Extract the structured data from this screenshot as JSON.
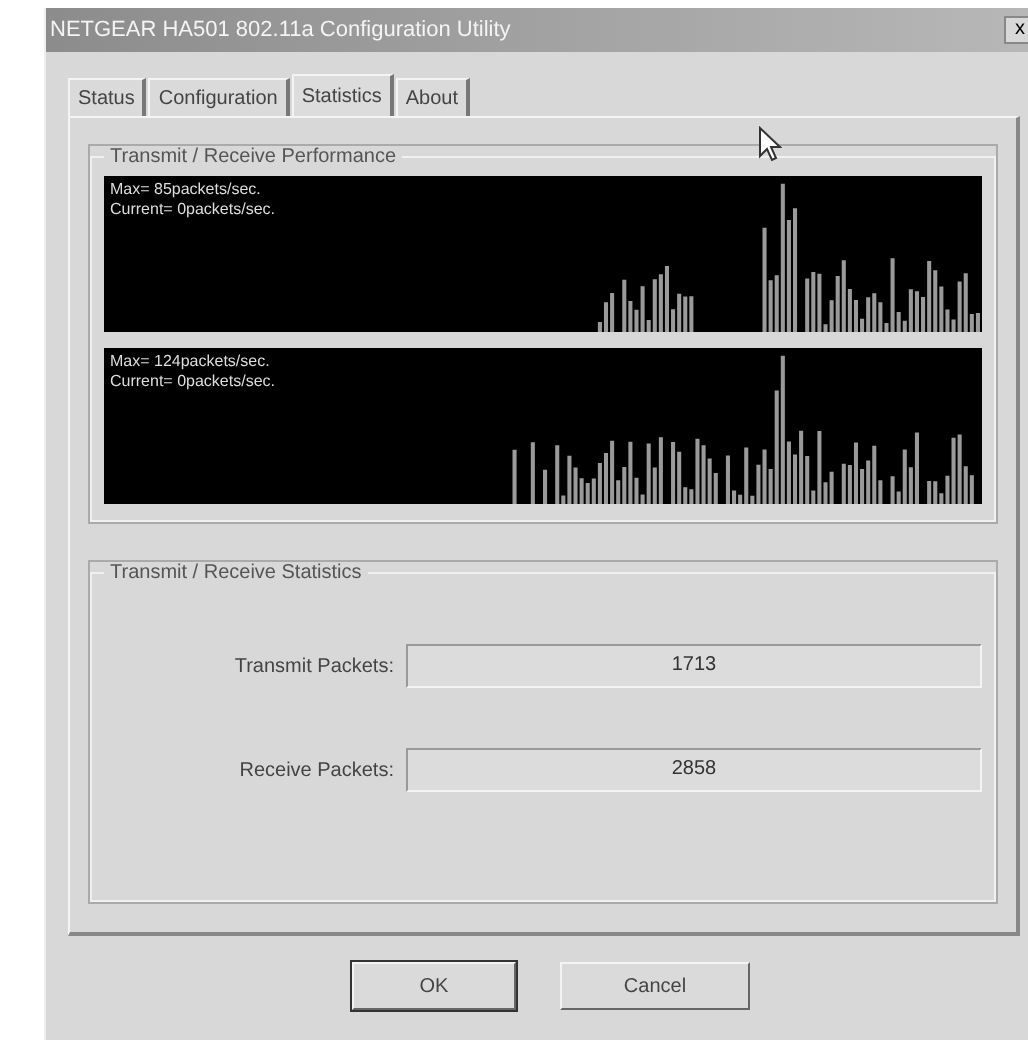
{
  "window": {
    "title": "NETGEAR HA501 802.11a Configuration Utility",
    "close": "x"
  },
  "tabs": [
    {
      "label": "Status",
      "selected": false
    },
    {
      "label": "Configuration",
      "selected": false
    },
    {
      "label": "Statistics",
      "selected": true
    },
    {
      "label": "About",
      "selected": false
    }
  ],
  "performance": {
    "title": "Transmit / Receive Performance",
    "graphs": [
      {
        "max": "Max= 85packets/sec.",
        "current": "Current= 0packets/sec."
      },
      {
        "max": "Max= 124packets/sec.",
        "current": "Current= 0packets/sec."
      }
    ]
  },
  "statistics": {
    "title": "Transmit / Receive Statistics",
    "fields": [
      {
        "label": "Transmit Packets:",
        "value": "1713"
      },
      {
        "label": "Receive Packets:",
        "value": "2858"
      }
    ]
  },
  "buttons": [
    "OK",
    "Cancel"
  ]
}
